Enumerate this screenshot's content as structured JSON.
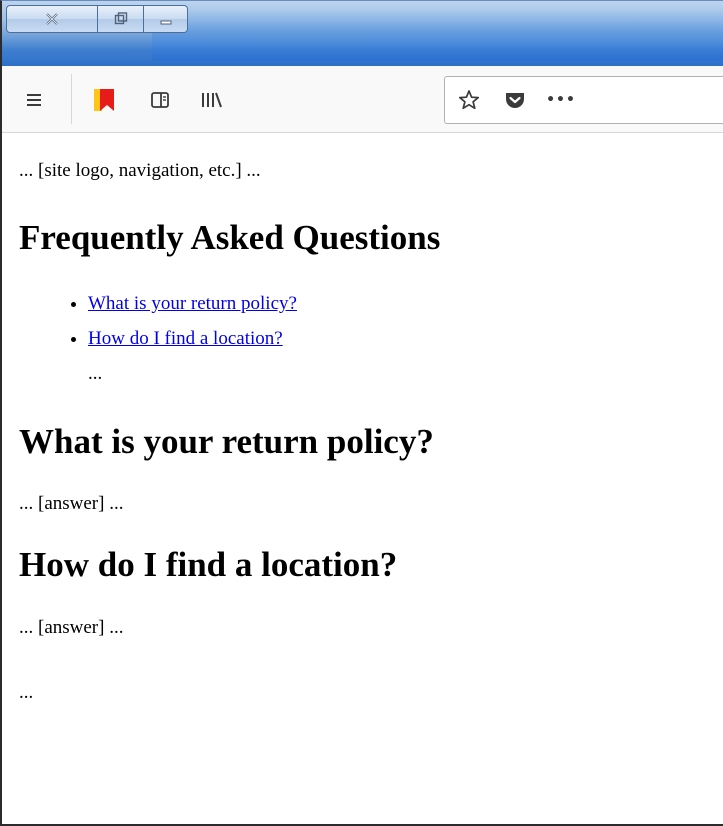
{
  "toolbar": {
    "menu_icon": "hamburger-menu-icon",
    "bookmark_icon": "bookmark-ribbon-icon",
    "sidebar_icon": "sidebar-icon",
    "library_icon": "library-icon",
    "star_icon": "star-icon",
    "pocket_icon": "pocket-icon",
    "more_label": "•••"
  },
  "page": {
    "header_text": "... [site logo, navigation, etc.] ...",
    "faq_title": "Frequently Asked Questions",
    "links": [
      {
        "label": "What is your return policy?"
      },
      {
        "label": "How do I find a location?"
      }
    ],
    "list_ellipsis": "...",
    "sections": [
      {
        "heading": "What is your return policy?",
        "answer": "... [answer] ..."
      },
      {
        "heading": "How do I find a location?",
        "answer": "... [answer] ..."
      }
    ],
    "footer_ellipsis": "..."
  },
  "colors": {
    "link": "#0000ee",
    "titlebar": "#3f7fd0",
    "toolbar": "#f9f9fa",
    "bookmark_red": "#e81b1b",
    "bookmark_yellow": "#ffc61a"
  }
}
